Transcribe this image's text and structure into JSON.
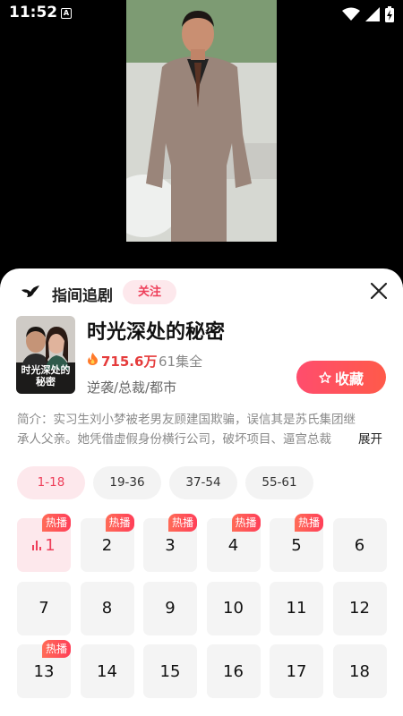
{
  "status_bar": {
    "time": "11:52",
    "notif": "A"
  },
  "sheet": {
    "title": "指间追剧",
    "follow_label": "关注"
  },
  "drama": {
    "title": "时光深处的秘密",
    "heat": "715.6万",
    "episodes_total": "61集全",
    "tags": "逆袭/总裁/都市",
    "collect_label": "收藏",
    "synopsis": "简介：实习生刘小梦被老男友顾建国欺骗，误信其是苏氏集团继承人父亲。她凭借虚假身份横行公司，破坏项目、逼宫总裁",
    "expand_label": "展开",
    "cover_title": "时光深处的秘密"
  },
  "range_tabs": [
    {
      "label": "1-18",
      "active": true
    },
    {
      "label": "19-36",
      "active": false
    },
    {
      "label": "37-54",
      "active": false
    },
    {
      "label": "55-61",
      "active": false
    }
  ],
  "hot_badge_label": "热播",
  "episodes": [
    {
      "n": "1",
      "hot": true,
      "active": true
    },
    {
      "n": "2",
      "hot": true
    },
    {
      "n": "3",
      "hot": true
    },
    {
      "n": "4",
      "hot": true
    },
    {
      "n": "5",
      "hot": true
    },
    {
      "n": "6",
      "hot": false
    },
    {
      "n": "7",
      "hot": false
    },
    {
      "n": "8",
      "hot": false
    },
    {
      "n": "9",
      "hot": false
    },
    {
      "n": "10",
      "hot": false
    },
    {
      "n": "11",
      "hot": false
    },
    {
      "n": "12",
      "hot": false
    },
    {
      "n": "13",
      "hot": true
    },
    {
      "n": "14",
      "hot": false
    },
    {
      "n": "15",
      "hot": false
    },
    {
      "n": "16",
      "hot": false
    },
    {
      "n": "17",
      "hot": false
    },
    {
      "n": "18",
      "hot": false
    }
  ],
  "colors": {
    "accent": "#ee3f5a",
    "accent_bg": "#fde8ec",
    "heat": "#e53b3b"
  }
}
